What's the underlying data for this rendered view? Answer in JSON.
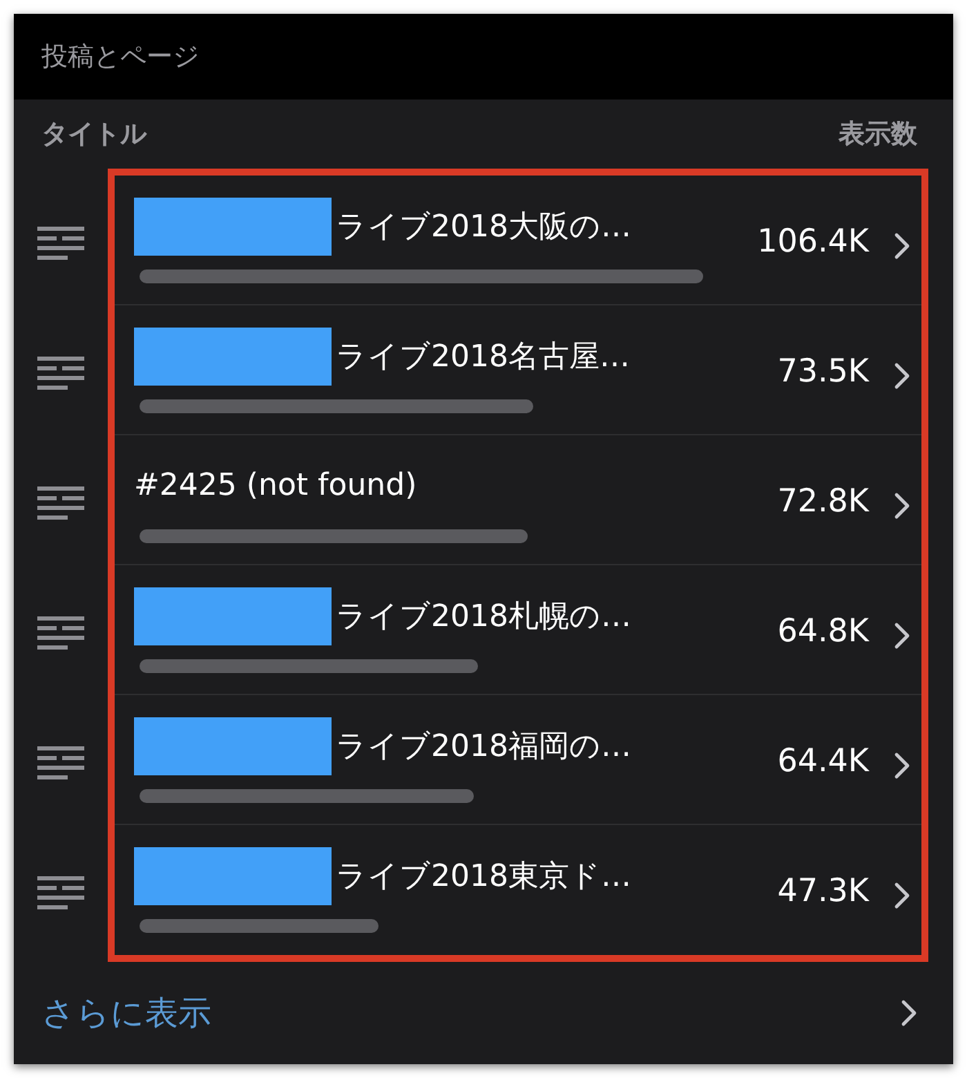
{
  "header": {
    "title": "投稿とページ"
  },
  "columns": {
    "title": "タイトル",
    "views": "表示数"
  },
  "posts": {
    "highlighted": true,
    "rows": [
      {
        "redacted": true,
        "title": "ライブ2018大阪の…",
        "views": "106.4K"
      },
      {
        "redacted": true,
        "title": "ライブ2018名古屋…",
        "views": "73.5K"
      },
      {
        "redacted": false,
        "title": "#2425 (not found)",
        "views": "72.8K"
      },
      {
        "redacted": true,
        "title": "ライブ2018札幌の…",
        "views": "64.8K"
      },
      {
        "redacted": true,
        "title": "ライブ2018福岡の…",
        "views": "64.4K"
      },
      {
        "redacted": true,
        "title": "ライブ2018東京ド…",
        "views": "47.3K"
      }
    ]
  },
  "footer": {
    "link": "さらに表示"
  }
}
